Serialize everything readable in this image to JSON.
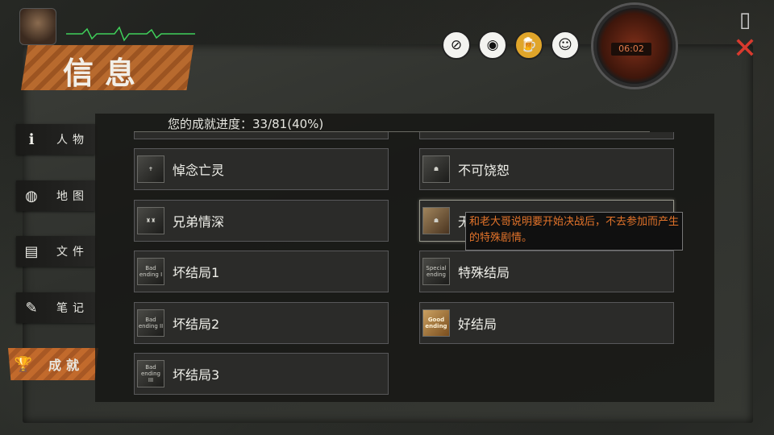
{
  "header": {
    "title": "信息",
    "clock_time": "06:02",
    "status_icons": [
      "pill-icon",
      "eye-icon",
      "beer-icon",
      "smile-icon"
    ]
  },
  "sidebar": {
    "items": [
      {
        "label": "人物",
        "icon": "info-icon"
      },
      {
        "label": "地图",
        "icon": "map-icon"
      },
      {
        "label": "文件",
        "icon": "document-icon"
      },
      {
        "label": "笔记",
        "icon": "note-icon"
      },
      {
        "label": "成就",
        "icon": "trophy-icon",
        "active": true
      }
    ]
  },
  "main": {
    "progress_text": "您的成就进度：33/81(40%)",
    "achievements_left": [
      {
        "name": "悼念亡灵",
        "thumb_text": ""
      },
      {
        "name": "兄弟情深",
        "thumb_text": ""
      },
      {
        "name": "坏结局1",
        "thumb_text": "Bad ending I"
      },
      {
        "name": "坏结局2",
        "thumb_text": "Bad ending II"
      },
      {
        "name": "坏结局3",
        "thumb_text": "Bad ending III"
      }
    ],
    "achievements_right": [
      {
        "name": "不可饶恕",
        "thumb_text": ""
      },
      {
        "name": "无",
        "thumb_text": ""
      },
      {
        "name": "特殊结局",
        "thumb_text": "Special ending"
      },
      {
        "name": "好结局",
        "thumb_text": "Good ending"
      }
    ],
    "tooltip": "和老大哥说明要开始决战后，不去参加而产生的特殊剧情。"
  },
  "colors": {
    "accent": "#b86a2e",
    "tooltip_text": "#e2732a",
    "exit": "#d83a2e"
  }
}
